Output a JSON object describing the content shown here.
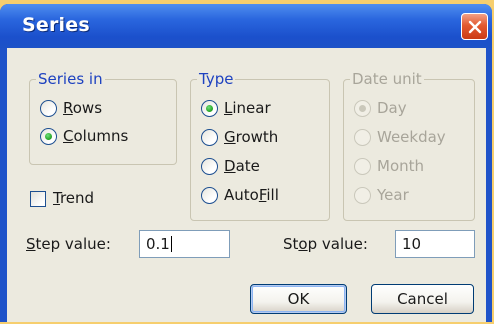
{
  "dialog": {
    "title": "Series",
    "close_icon": "close-icon",
    "colors": {
      "title_bar": "#2a66de",
      "close_button": "#e35a31",
      "client": "#eceadf",
      "group_label": "#1e42c0",
      "radio_selected": "#21a121"
    }
  },
  "series_in": {
    "label": "Series in",
    "options": [
      {
        "key": "R",
        "rest": "ows",
        "selected": false
      },
      {
        "key": "C",
        "rest": "olumns",
        "selected": true
      }
    ]
  },
  "type": {
    "label": "Type",
    "options": [
      {
        "key": "L",
        "rest": "inear",
        "selected": true
      },
      {
        "key": "G",
        "rest": "rowth",
        "selected": false
      },
      {
        "key": "D",
        "rest": "ate",
        "selected": false
      },
      {
        "pre": "Auto",
        "key": "F",
        "rest": "ill",
        "selected": false
      }
    ]
  },
  "date_unit": {
    "label": "Date unit",
    "enabled": false,
    "options": [
      {
        "label": "Day",
        "selected": true
      },
      {
        "label": "Weekday",
        "selected": false
      },
      {
        "label": "Month",
        "selected": false
      },
      {
        "label": "Year",
        "selected": false
      }
    ]
  },
  "trend": {
    "key": "T",
    "rest": "rend",
    "checked": false
  },
  "step_value": {
    "key": "S",
    "rest": "tep value:",
    "value": "0.1"
  },
  "stop_value": {
    "pre": "St",
    "key": "o",
    "rest": "p value:",
    "value": "10"
  },
  "buttons": {
    "ok": "OK",
    "cancel": "Cancel"
  }
}
